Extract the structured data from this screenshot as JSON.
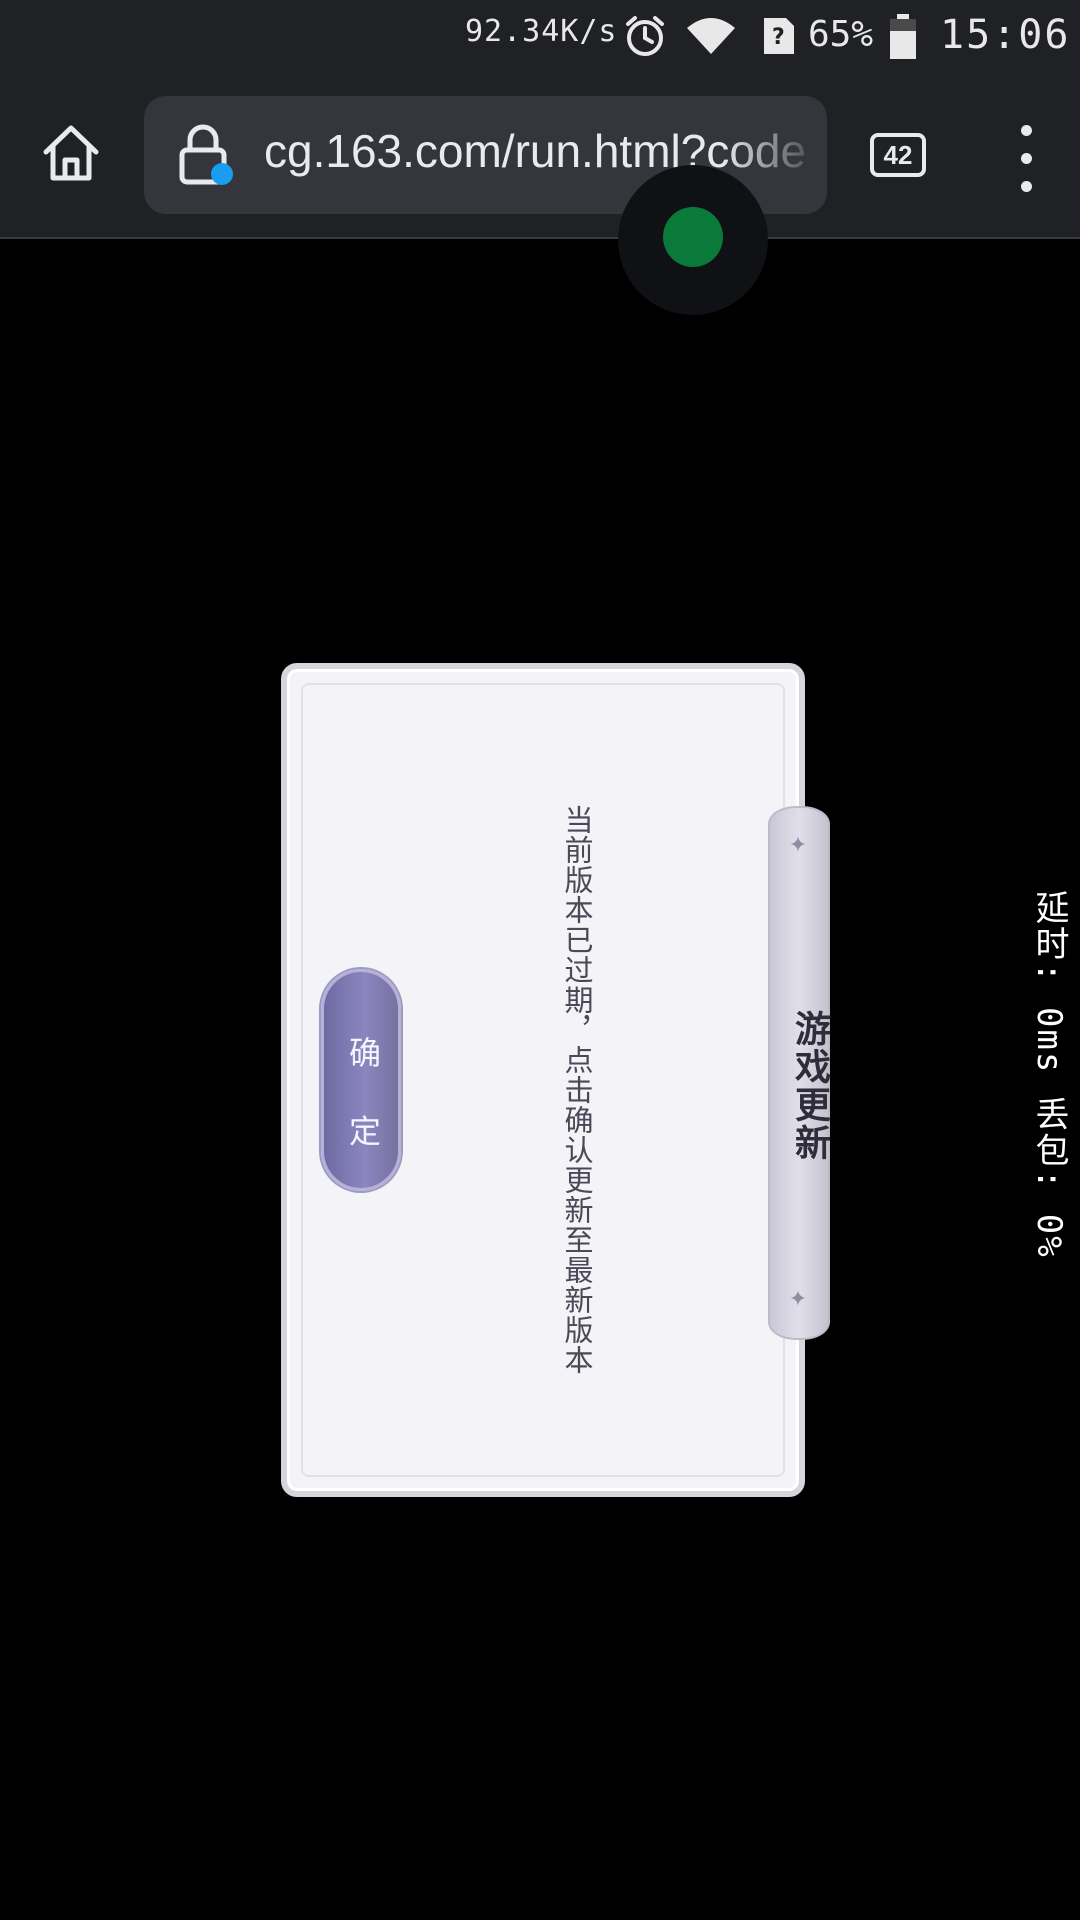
{
  "status_bar": {
    "network_speed": "92.34K/s",
    "battery_percent": "65%",
    "time": "15:06",
    "icons": [
      "alarm-icon",
      "wifi-icon",
      "sim-unknown-icon",
      "battery-icon"
    ]
  },
  "browser": {
    "url": "cg.163.com/run.html?code",
    "tab_count": "42",
    "icons": [
      "home-icon",
      "lock-icon",
      "menu-icon"
    ]
  },
  "dialog": {
    "title": "游戏更新",
    "message": "当前版本已过期，点击确认更新至最新版本",
    "confirm_label": "确 定"
  },
  "overlay": {
    "latency_text": "延时: 0ms 丢包: 0%"
  },
  "colors": {
    "browser_bg": "#202124",
    "button_accent": "#7b76b0",
    "dialog_bg": "#f4f3f8"
  }
}
